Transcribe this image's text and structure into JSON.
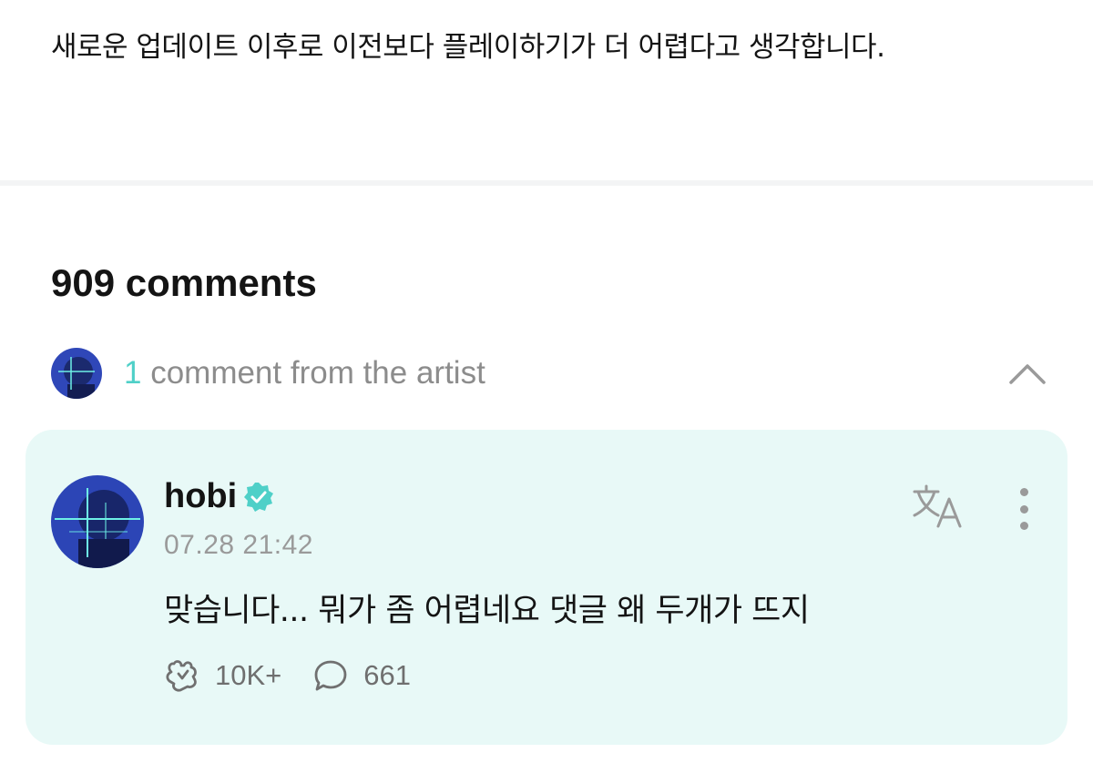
{
  "post": {
    "body": "새로운 업데이트 이후로 이전보다 플레이하기가 더 어렵다고 생각합니다."
  },
  "comments": {
    "heading": "909 comments",
    "artist_summary": {
      "count": "1",
      "label": " comment from the artist",
      "toggle_icon": "chevron-up-icon"
    },
    "artist_comment": {
      "username": "hobi",
      "verified_icon": "verified-badge-icon",
      "timestamp": "07.28 21:42",
      "text": "맞습니다... 뭐가 좀 어렵네요 댓글 왜 두개가 뜨지",
      "likes": "10K+",
      "replies": "661",
      "translate_icon": "translate-icon",
      "more_icon": "more-vertical-icon"
    }
  },
  "colors": {
    "accent": "#4fd0c8",
    "card_background": "#e8f9f7",
    "muted_text": "#8c8c8c"
  }
}
